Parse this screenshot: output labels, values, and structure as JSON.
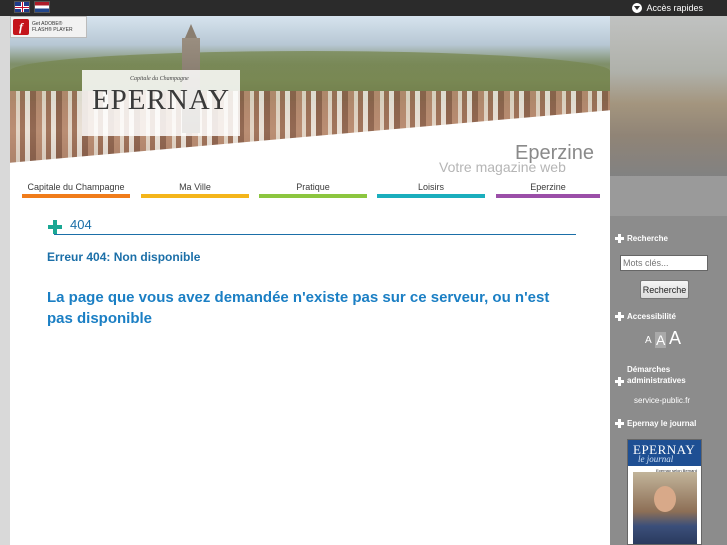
{
  "topbar": {
    "quick_access_label": "Accès rapides"
  },
  "flash": {
    "line1": "Get ADOBE®",
    "line2": "FLASH® PLAYER"
  },
  "logo": {
    "subtitle": "Capitale du Champagne",
    "name": "EPERNAY"
  },
  "magazine": {
    "title": "Eperzine",
    "subtitle": "Votre magazine web"
  },
  "nav": {
    "items": [
      {
        "label": "Capitale du Champagne",
        "color": "#f07c1a"
      },
      {
        "label": "Ma Ville",
        "color": "#f4b51a"
      },
      {
        "label": "Pratique",
        "color": "#8cc63f"
      },
      {
        "label": "Loisirs",
        "color": "#1aaebd"
      },
      {
        "label": "Eperzine",
        "color": "#9b4fa8"
      }
    ]
  },
  "content": {
    "heading": "404",
    "error_title": "Erreur 404: Non disponible",
    "error_message": "La page que vous avez demandée n'existe pas sur ce serveur, ou n'est pas disponible"
  },
  "sidebar": {
    "search_heading": "Recherche",
    "search_placeholder": "Mots clés...",
    "search_button": "Recherche",
    "accessibility_heading": "Accessibilité",
    "font_small": "A",
    "font_medium": "A",
    "font_large": "A",
    "demarches_heading_line1": "Démarches",
    "demarches_heading_line2": "administratives",
    "service_link": "service-public.fr",
    "journal_heading": "Epernay le journal",
    "journal_cover_name": "EPERNAY",
    "journal_cover_sub": "le journal",
    "journal_cover_caption": "Epernay selon Bernard Stasi"
  },
  "colors": {
    "accent_blue": "#1b6fa8",
    "plus_teal": "#1aa794",
    "sidebar_grey": "#8c8c8c"
  }
}
